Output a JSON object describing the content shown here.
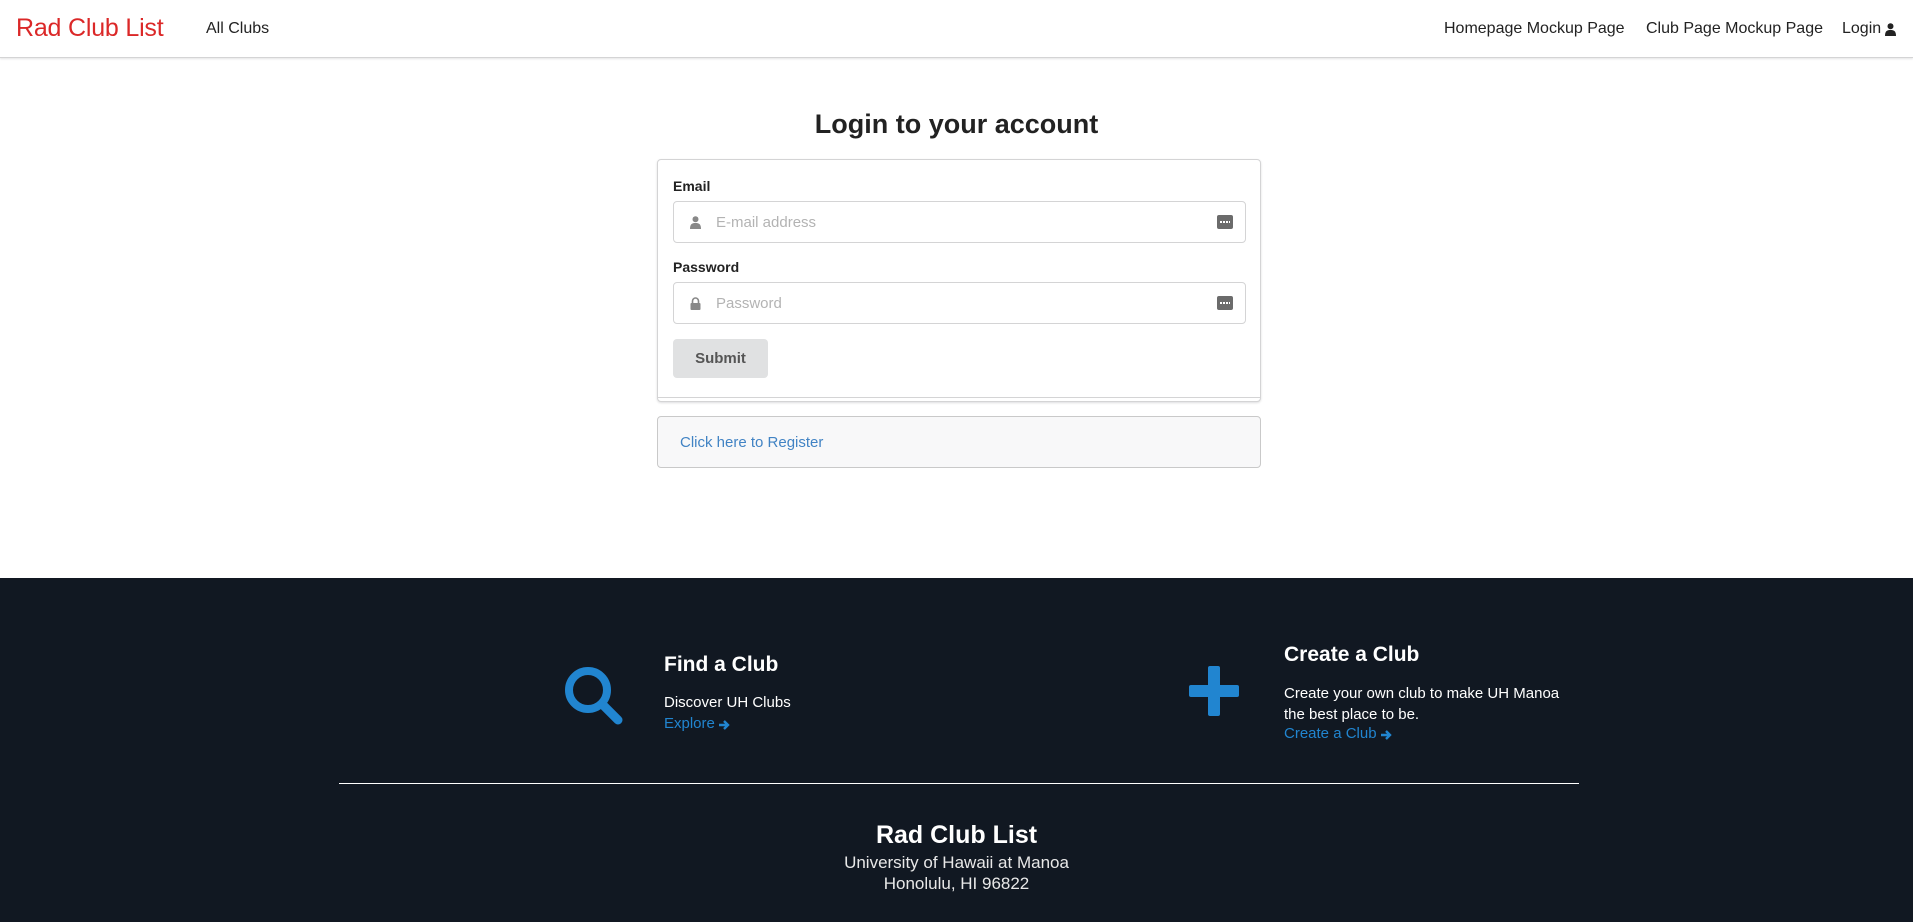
{
  "navbar": {
    "brand": "Rad Club List",
    "all_clubs": "All Clubs",
    "homepage_mockup": "Homepage Mockup Page",
    "club_page_mockup": "Club Page Mockup Page",
    "login": "Login",
    "login_icon": "user-icon"
  },
  "login_form": {
    "title": "Login to your account",
    "email_label": "Email",
    "email_placeholder": "E-mail address",
    "email_icon": "user-icon",
    "password_label": "Password",
    "password_placeholder": "Password",
    "password_icon": "lock-icon",
    "autofill_icon": "password-manager-icon",
    "submit_label": "Submit",
    "register_link": "Click here to Register"
  },
  "footer": {
    "find": {
      "icon": "search-icon",
      "title": "Find a Club",
      "description": "Discover UH Clubs",
      "link": "Explore"
    },
    "create": {
      "icon": "plus-icon",
      "title": "Create a Club",
      "description": "Create your own club to make UH Manoa the best place to be.",
      "link": "Create a Club"
    },
    "brand": "Rad Club List",
    "address_line1": "University of Hawaii at Manoa",
    "address_line2": "Honolulu, HI 96822"
  },
  "colors": {
    "brand_red": "#db2828",
    "link_blue": "#4183c4",
    "footer_accent": "#2185d0",
    "footer_bg": "#111822"
  }
}
